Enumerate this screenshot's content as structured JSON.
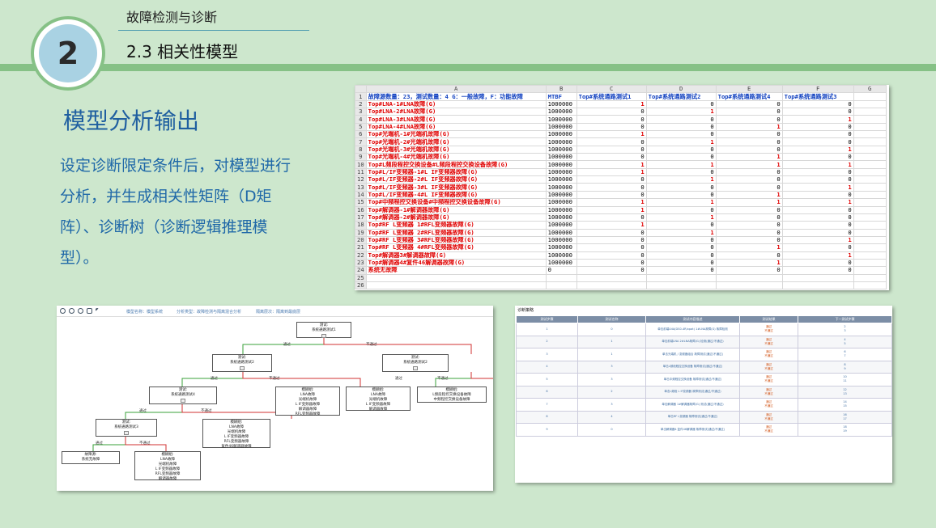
{
  "header": {
    "number": "2",
    "subtitle": "故障检测与诊断",
    "title": "2.3 相关性模型"
  },
  "section": {
    "title": "模型分析输出",
    "body": "设定诊断限定条件后，对模型进行分析，并生成相关性矩阵（D矩阵）、诊断树（诊断逻辑推理模型）。"
  },
  "sheet": {
    "col_letters": [
      "",
      "A",
      "B",
      "C",
      "D",
      "E",
      "F",
      "G"
    ],
    "header_row": [
      "故障源数量：23，测试数量：4 G：一般故障，F：功能故障",
      "MTBF",
      "Top#系统通路测试1",
      "Top#系统通路测试2",
      "Top#系统通路测试4",
      "Top#系统通路测试3",
      ""
    ],
    "rows": [
      {
        "name": "Top#LNA-1#LNA故障(G)",
        "mtbf": "1000000",
        "v": [
          "1",
          "0",
          "0",
          "0"
        ]
      },
      {
        "name": "Top#LNA-2#LNA故障(G)",
        "mtbf": "1000000",
        "v": [
          "0",
          "1",
          "0",
          "0"
        ]
      },
      {
        "name": "Top#LNA-3#LNA故障(G)",
        "mtbf": "1000000",
        "v": [
          "0",
          "0",
          "0",
          "1"
        ]
      },
      {
        "name": "Top#LNA-4#LNA故障(G)",
        "mtbf": "1000000",
        "v": [
          "0",
          "0",
          "1",
          "0"
        ]
      },
      {
        "name": "Top#光端机-1#光端机故障(G)",
        "mtbf": "1000000",
        "v": [
          "1",
          "0",
          "0",
          "0"
        ]
      },
      {
        "name": "Top#光端机-2#光端机故障(G)",
        "mtbf": "1000000",
        "v": [
          "0",
          "1",
          "0",
          "0"
        ]
      },
      {
        "name": "Top#光端机-3#光端机故障(G)",
        "mtbf": "1000000",
        "v": [
          "0",
          "0",
          "0",
          "1"
        ]
      },
      {
        "name": "Top#光端机-4#光端机故障(G)",
        "mtbf": "1000000",
        "v": [
          "0",
          "0",
          "1",
          "0"
        ]
      },
      {
        "name": "Top#L频段程控交换设备#L频段程控交换设备故障(G)",
        "mtbf": "1000000",
        "v": [
          "1",
          "1",
          "1",
          "1"
        ]
      },
      {
        "name": "Top#L/IF变频器-1#L IF变频器故障(G)",
        "mtbf": "1000000",
        "v": [
          "1",
          "0",
          "0",
          "0"
        ]
      },
      {
        "name": "Top#L/IF变频器-2#L IF变频器故障(G)",
        "mtbf": "1000000",
        "v": [
          "0",
          "1",
          "0",
          "0"
        ]
      },
      {
        "name": "Top#L/IF变频器-3#L IF变频器故障(G)",
        "mtbf": "1000000",
        "v": [
          "0",
          "0",
          "0",
          "1"
        ]
      },
      {
        "name": "Top#L/IF变频器-4#L IF变频器故障(G)",
        "mtbf": "1000000",
        "v": [
          "0",
          "0",
          "1",
          "0"
        ]
      },
      {
        "name": "Top#中频程控交换设备#中频程控交换设备故障(G)",
        "mtbf": "1000000",
        "v": [
          "1",
          "1",
          "1",
          "1"
        ]
      },
      {
        "name": "Top#解调器-1#解调器故障(G)",
        "mtbf": "1000000",
        "v": [
          "1",
          "0",
          "0",
          "0"
        ]
      },
      {
        "name": "Top#解调器-2#解调器故障(G)",
        "mtbf": "1000000",
        "v": [
          "0",
          "1",
          "0",
          "0"
        ]
      },
      {
        "name": "Top#RF L变频器 1#RFL变频器故障(G)",
        "mtbf": "1000000",
        "v": [
          "1",
          "0",
          "0",
          "0"
        ]
      },
      {
        "name": "Top#RF L变频器 2#RFL变频器故障(G)",
        "mtbf": "1000000",
        "v": [
          "0",
          "1",
          "0",
          "0"
        ]
      },
      {
        "name": "Top#RF L变频器 3#RFL变频器故障(G)",
        "mtbf": "1000000",
        "v": [
          "0",
          "0",
          "0",
          "1"
        ]
      },
      {
        "name": "Top#RF L变频器 4#RFL变频器故障(G)",
        "mtbf": "1000000",
        "v": [
          "0",
          "0",
          "1",
          "0"
        ]
      },
      {
        "name": "Top#解调器3#解调器故障(G)",
        "mtbf": "1000000",
        "v": [
          "0",
          "0",
          "0",
          "1"
        ]
      },
      {
        "name": "Top#解调器4#复件46解调器故障(G)",
        "mtbf": "1000000",
        "v": [
          "0",
          "0",
          "1",
          "0"
        ]
      },
      {
        "name": "系统无故障",
        "mtbf": "0",
        "v": [
          "0",
          "0",
          "0",
          "0"
        ]
      }
    ]
  },
  "tree": {
    "toolbar": {
      "model": "模型名称：模型系统",
      "type": "分析类型：故障检测与隔离混合分析",
      "level": "隔离层次：隔离到最底层"
    },
    "nodes": {
      "n1": "测试:\n系统通路测试1",
      "n2": "测试:\n系统通路测试2",
      "n3": "测试:\n系统通路测试2",
      "n4": "测试:\n系统通路测试4",
      "n5": "模糊组:\nLNA故障\n光端机故障\nL IF变频器故障\n解调器故障\nRFL变频器故障",
      "n6": "模糊组:\nLNA故障\n光端机故障\nL IF变频器故障\n解调器故障",
      "n7": "模糊组:\nL频段程控交换设备故障\n中频程控交换设备故障",
      "n8": "测试:\n系统通路测试3",
      "n9": "模糊组:\nLNA故障\n光端机故障\nL IF变频器故障\nRFL变频器故障\n复件46解调器故障",
      "n10": "故障源:\n系统无故障",
      "n11": "模糊组:\nLNA故障\n光端机故障\nL IF变频器故障\nRFL变频器故障\n解调器故障"
    },
    "edge_pass": "通过",
    "edge_fail": "不通过"
  },
  "strategy": {
    "title": "诊断策略",
    "headers": [
      "测试步骤",
      "测试名称",
      "测试内容描述",
      "测试结果",
      "下一测试步骤"
    ],
    "result_pass": "通过",
    "result_fail": "不通过",
    "rows": [
      {
        "step": "1",
        "name": "0",
        "desc": "单击前端LNA(DS0-4R/xpat) 1#LNA故障(G) 故障检测",
        "r1": "通过",
        "n1": "2",
        "r2": "不通过",
        "n2": "3"
      },
      {
        "step": "2",
        "name": "1",
        "desc": "单击前端LNA 2#LNA故障(G) 检测(通过/不通过)",
        "r1": "通过",
        "n1": "4",
        "r2": "不通过",
        "n2": "5"
      },
      {
        "step": "3",
        "name": "1",
        "desc": "单击光端机 / 变频器组合 故障测试(通过/不通过)",
        "r1": "通过",
        "n1": "6",
        "r2": "不通过",
        "n2": "7"
      },
      {
        "step": "4",
        "name": "3",
        "desc": "单击L频段程控交换设备 故障测试(通过/不通过)",
        "r1": "通过",
        "n1": "8",
        "r2": "不通过",
        "n2": "9"
      },
      {
        "step": "5",
        "name": "3",
        "desc": "单击中频程控交换设备 故障测试(通过/不通过)",
        "r1": "通过",
        "n1": "10",
        "r2": "不通过",
        "n2": "11"
      },
      {
        "step": "6",
        "name": "2",
        "desc": "单击L频段 L IF变频器 故障测试(通过/不通过)",
        "r1": "通过",
        "n1": "12",
        "r2": "不通过",
        "n2": "13"
      },
      {
        "step": "7",
        "name": "3",
        "desc": "单击解调器 1#解调器故障(G) 测试(通过/不通过)",
        "r1": "通过",
        "n1": "14",
        "r2": "不通过",
        "n2": "15"
      },
      {
        "step": "8",
        "name": "4",
        "desc": "单击RF L变频器 故障测试(通过/不通过)",
        "r1": "通过",
        "n1": "16",
        "r2": "不通过",
        "n2": "17"
      },
      {
        "step": "9",
        "name": "0",
        "desc": "单击解调器4 复件46解调器 故障测试(通过/不通过)",
        "r1": "通过",
        "n1": "18",
        "r2": "不通过",
        "n2": "19"
      }
    ]
  }
}
